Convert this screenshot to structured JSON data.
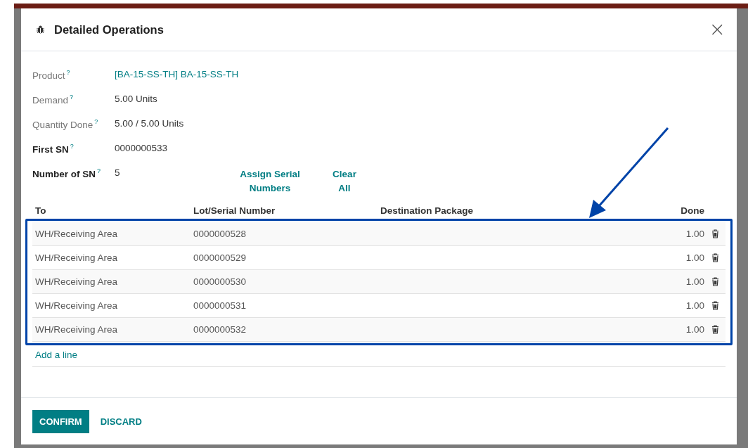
{
  "dialog": {
    "title": "Detailed Operations",
    "close": "×"
  },
  "fields": [
    {
      "label": "Product",
      "help": "?",
      "value": "[BA-15-SS-TH] BA-15-SS-TH",
      "kind": "link",
      "required": false
    },
    {
      "label": "Demand",
      "help": "?",
      "value": "5.00 Units",
      "kind": "text",
      "required": false
    },
    {
      "label": "Quantity Done",
      "help": "?",
      "value": "5.00 / 5.00 Units",
      "kind": "text",
      "required": false
    },
    {
      "label": "First SN",
      "help": "?",
      "value": "0000000533",
      "kind": "text",
      "required": true
    },
    {
      "label": "Number of SN",
      "help": "?",
      "value": "5",
      "kind": "text",
      "required": true
    }
  ],
  "serial_actions": [
    "Assign Serial Numbers",
    "Clear All"
  ],
  "table": {
    "columns": [
      "To",
      "Lot/Serial Number",
      "Destination Package",
      "Done"
    ],
    "rows": [
      {
        "to": "WH/Receiving Area",
        "lot": "0000000528",
        "done": "1.00"
      },
      {
        "to": "WH/Receiving Area",
        "lot": "0000000529",
        "done": "1.00"
      },
      {
        "to": "WH/Receiving Area",
        "lot": "0000000530",
        "done": "1.00"
      },
      {
        "to": "WH/Receiving Area",
        "lot": "0000000531",
        "done": "1.00"
      },
      {
        "to": "WH/Receiving Area",
        "lot": "0000000532",
        "done": "1.00"
      }
    ],
    "add_line": "Add a line"
  },
  "buttons": [
    {
      "label": "CONFIRM",
      "kind": "primary"
    },
    {
      "label": "DISCARD",
      "kind": "secondary"
    }
  ]
}
